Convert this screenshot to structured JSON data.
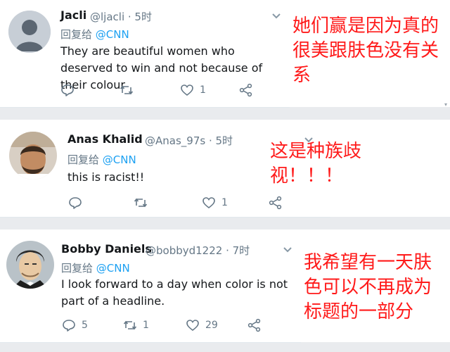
{
  "tweets": [
    {
      "display_name": "Jacli",
      "meta": "@ljacli · 5时",
      "reply_prefix": "回复给",
      "reply_mention": "@CNN",
      "text": "They are beautiful women who deserved to win and not because of their colour",
      "replies": "",
      "retweets": "",
      "likes": "1",
      "annotation": "她们赢是因为真的很美跟肤色没有关系"
    },
    {
      "display_name": "Anas Khalid",
      "meta": "@Anas_97s · 5时",
      "reply_prefix": "回复给",
      "reply_mention": "@CNN",
      "text": "this is racist!!",
      "replies": "",
      "retweets": "",
      "likes": "1",
      "annotation": "这是种族歧视！！！"
    },
    {
      "display_name": "Bobby Daniels",
      "meta": "@bobbyd1222 · 7时",
      "reply_prefix": "回复给",
      "reply_mention": "@CNN",
      "text": "I look forward to a day when color is not part of a headline.",
      "replies": "5",
      "retweets": "1",
      "likes": "29",
      "annotation": "我希望有一天肤色可以不再成为标题的一部分"
    }
  ],
  "icons": {
    "reply": "speech-bubble",
    "retweet": "two-arrows",
    "like": "heart",
    "share": "share-nodes",
    "caret": "chevron-down"
  },
  "colors": {
    "mention": "#1da1f2",
    "secondary_text": "#657786",
    "annotation": "#ff1a1a"
  }
}
